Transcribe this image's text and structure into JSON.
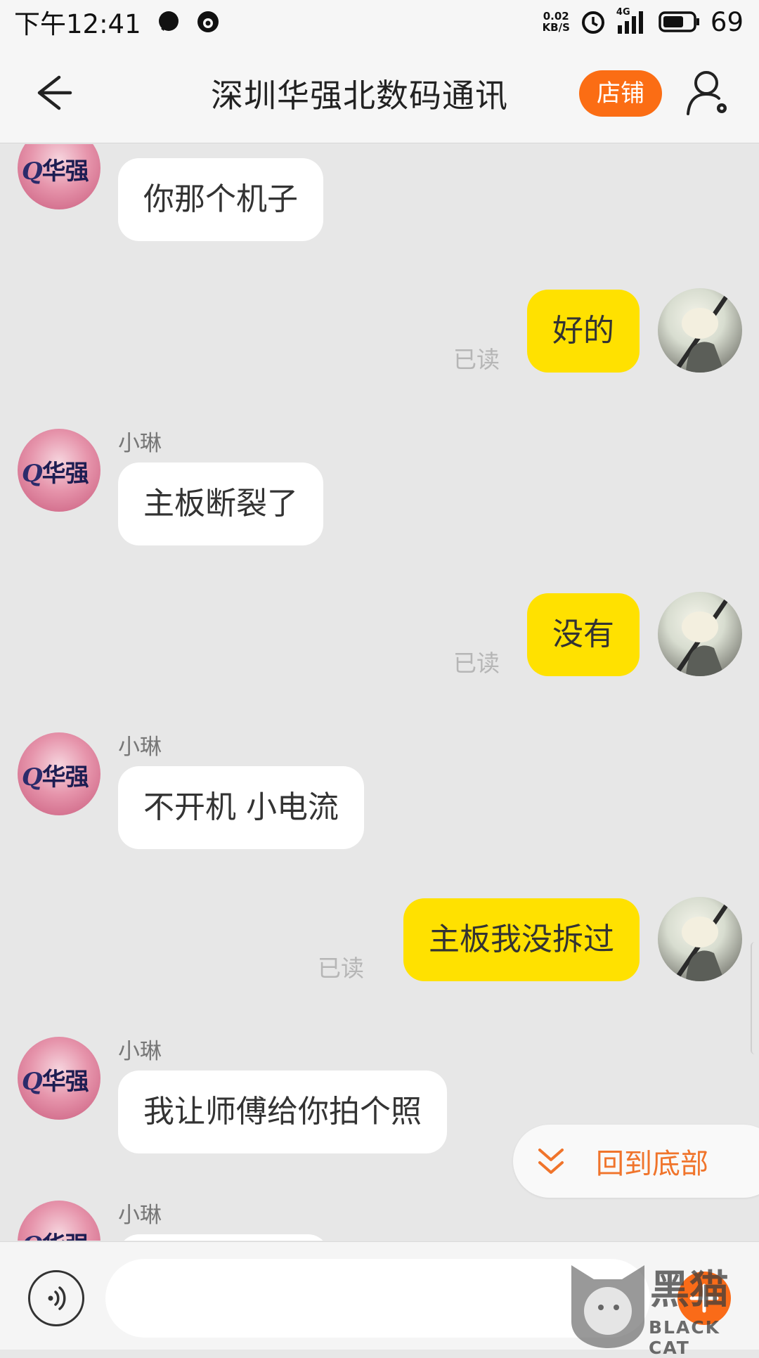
{
  "status_bar": {
    "time": "下午12:41",
    "net_speed_value": "0.02",
    "net_speed_unit": "KB/S",
    "signal_label": "4G",
    "battery_level": "69",
    "icons": [
      "chat-bubble-icon",
      "notification-drop-icon",
      "alarm-icon",
      "signal-icon",
      "battery-icon"
    ]
  },
  "header": {
    "title": "深圳华强北数码通讯",
    "shop_button": "店铺",
    "back_icon": "back-arrow-icon",
    "user_settings_icon": "user-settings-icon"
  },
  "messages": [
    {
      "side": "left",
      "sender": "",
      "text": "你那个机子"
    },
    {
      "side": "right",
      "text": "好的",
      "status": "已读"
    },
    {
      "side": "left",
      "sender": "小琳",
      "text": "主板断裂了"
    },
    {
      "side": "right",
      "text": "没有",
      "status": "已读"
    },
    {
      "side": "left",
      "sender": "小琳",
      "text": "不开机 小电流"
    },
    {
      "side": "right",
      "text": "主板我没拆过",
      "status": "已读"
    },
    {
      "side": "left",
      "sender": "小琳",
      "text": "我让师傅给你拍个照"
    },
    {
      "side": "left",
      "sender": "小琳",
      "text": ""
    }
  ],
  "avatar_logo_text": "华强",
  "jump_to_bottom": {
    "label": "回到底部",
    "icon": "double-chevron-down-icon"
  },
  "input_bar": {
    "voice_icon": "voice-icon",
    "placeholder": "",
    "plus_icon": "plus-icon"
  },
  "watermark": {
    "title": "黑猫",
    "subtitle": "BLACK CAT"
  },
  "colors": {
    "accent_orange": "#fb6d14",
    "my_bubble": "#ffe100",
    "their_bubble": "#ffffff",
    "background": "#e7e7e7"
  }
}
